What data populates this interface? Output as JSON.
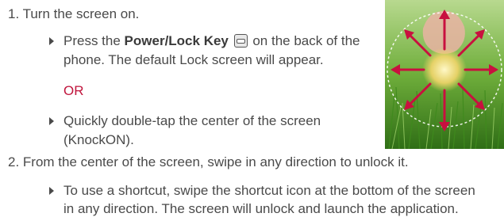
{
  "steps": {
    "s1": {
      "label": "1. Turn the screen on."
    },
    "b1": {
      "pre": "Press the ",
      "key": "Power/Lock Key",
      "post": " on the back of the",
      "line2": "phone. The default Lock screen will appear."
    },
    "or": "OR",
    "b2": {
      "line1": "Quickly double-tap the center of the screen",
      "line2": "(KnockON)."
    },
    "s2": {
      "label": "2. From the center of the screen, swipe in any direction to unlock it."
    },
    "b3": {
      "line1": "To use a shortcut, swipe the shortcut icon at the bottom of the screen",
      "line2": "in any direction. The screen will unlock and launch the application."
    }
  },
  "icons": {
    "bullet": "triangle-bullet-icon",
    "key": "power-lock-key-icon"
  },
  "colors": {
    "text": "#4a4a4a",
    "accent": "#c0143c",
    "grass": "#3d8f1e",
    "arrow": "#c8103f"
  }
}
